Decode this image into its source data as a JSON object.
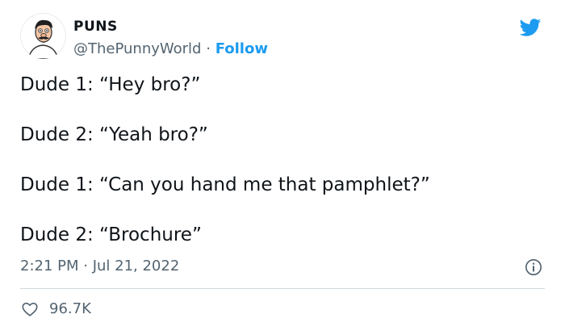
{
  "author": {
    "name": "PUNS",
    "handle": "@ThePunnyWorld",
    "separator": "·",
    "follow_label": "Follow"
  },
  "tweet": {
    "lines": [
      "Dude 1: “Hey bro?”",
      "Dude 2: “Yeah bro?”",
      "Dude 1: “Can you hand me that pamphlet?”",
      "Dude 2: “Brochure”"
    ],
    "timestamp": "2:21 PM · Jul 21, 2022"
  },
  "engagement": {
    "likes": "96.7K"
  },
  "icons": {
    "brand": "twitter-bird-icon",
    "info": "info-icon",
    "like": "heart-icon"
  },
  "colors": {
    "brand_blue": "#1d9bf0",
    "text_primary": "#0f1419",
    "text_secondary": "#536471",
    "divider": "#cfd9de"
  }
}
